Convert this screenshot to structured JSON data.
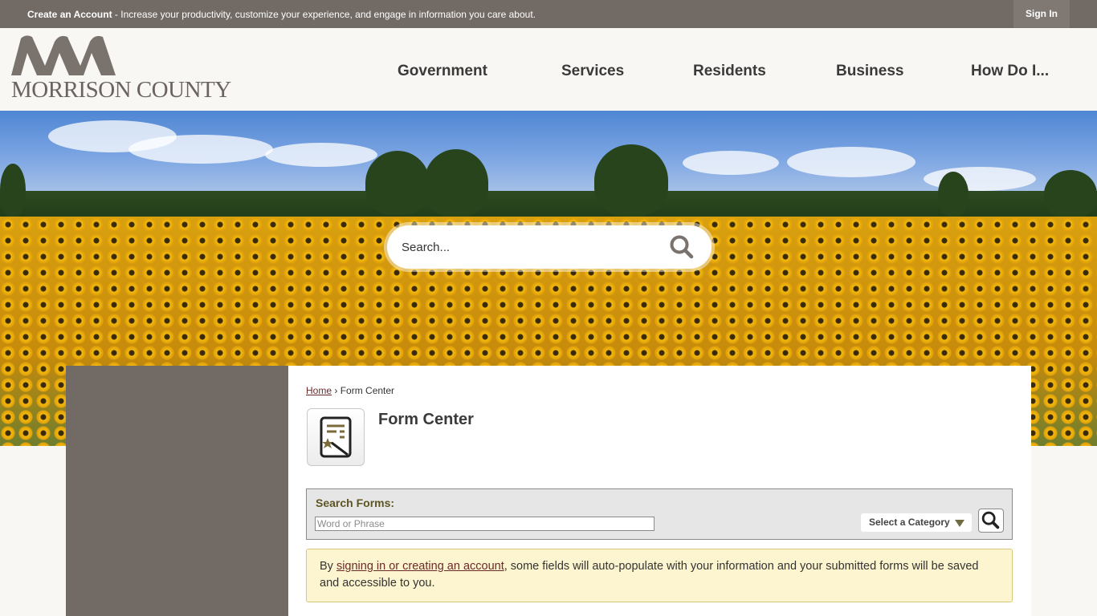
{
  "topbar": {
    "account_strong": "Create an Account",
    "account_rest": " - Increase your productivity, customize your experience, and engage in information you care about.",
    "signin_label": "Sign In"
  },
  "header": {
    "logo_text": "MORRISON COUNTY",
    "nav": [
      "Government",
      "Services",
      "Residents",
      "Business",
      "How Do I..."
    ]
  },
  "hero": {
    "search_placeholder": "Search..."
  },
  "breadcrumb": {
    "home": "Home",
    "separator": "›",
    "current": "Form Center"
  },
  "page": {
    "title": "Form Center"
  },
  "search_forms": {
    "label": "Search Forms:",
    "input_placeholder": "Word or Phrase",
    "category_label": "Select a Category"
  },
  "notice": {
    "before": "By ",
    "link": "signing in or creating an account",
    "after": ", some fields will auto-populate with your information and your submitted forms will be saved and accessible to you."
  },
  "colors": {
    "topbar": "#716a65",
    "header_bg": "#f9f7f3",
    "link": "#6b2a2a",
    "notice_bg": "#fdf5cf"
  }
}
